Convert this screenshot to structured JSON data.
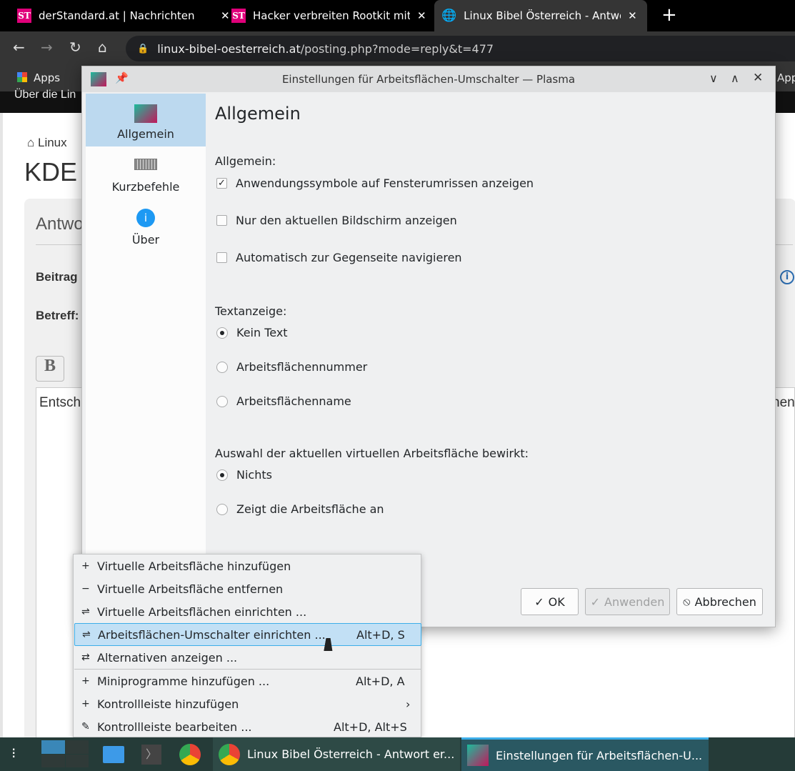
{
  "browser": {
    "tabs": [
      {
        "icon": "ST",
        "title": "derStandard.at | Nachrichten",
        "close": "✕"
      },
      {
        "icon": "ST",
        "title": "Hacker verbreiten Rootkit mit",
        "close": "✕"
      },
      {
        "icon": "globe-icon",
        "title": "Linux Bibel Österreich - Antwort",
        "close": "✕"
      }
    ],
    "new_tab": "+",
    "url_domain": "linux-bibel-oesterreich.at",
    "url_path": "/posting.php?mode=reply&t=477",
    "bookmarks": {
      "apps": "Apps",
      "right": "App"
    }
  },
  "webpage": {
    "top_text": "Über die Lin",
    "breadcrumb": "Linux",
    "heading": "KDE",
    "panel_title": "Antwo",
    "field1": "Beitrag",
    "field2": "Betreff:",
    "bold_button": "B",
    "textarea_start": "Entsch",
    "textarea_end": "nen"
  },
  "dialog": {
    "title": "Einstellungen für Arbeitsflächen-Umschalter — Plasma",
    "sidebar": [
      {
        "label": "Allgemein",
        "selected": true
      },
      {
        "label": "Kurzbefehle"
      },
      {
        "label": "Über"
      }
    ],
    "page_title": "Allgemein",
    "group1": {
      "label": "Allgemein:",
      "checkboxes": [
        {
          "label": "Anwendungssymbole auf Fensterumrissen anzeigen",
          "checked": true
        },
        {
          "label": "Nur den aktuellen Bildschirm anzeigen",
          "checked": false
        },
        {
          "label": "Automatisch zur Gegenseite navigieren",
          "checked": false
        }
      ]
    },
    "group2": {
      "label": "Textanzeige:",
      "radios": [
        {
          "label": "Kein Text",
          "checked": true
        },
        {
          "label": "Arbeitsflächennummer",
          "checked": false
        },
        {
          "label": "Arbeitsflächenname",
          "checked": false
        }
      ]
    },
    "group3": {
      "label": "Auswahl der aktuellen virtuellen Arbeitsfläche bewirkt:",
      "radios": [
        {
          "label": "Nichts",
          "checked": true
        },
        {
          "label": "Zeigt die Arbeitsfläche an",
          "checked": false
        }
      ]
    },
    "buttons": {
      "ok": "OK",
      "apply": "Anwenden",
      "cancel": "Abbrechen"
    }
  },
  "context_menu": [
    {
      "icon": "+",
      "label": "Virtuelle Arbeitsfläche hinzufügen",
      "shortcut": ""
    },
    {
      "icon": "−",
      "label": "Virtuelle Arbeitsfläche entfernen",
      "shortcut": ""
    },
    {
      "icon": "⇌",
      "label": "Virtuelle Arbeitsflächen einrichten ...",
      "shortcut": ""
    },
    {
      "icon": "⇌",
      "label": "Arbeitsflächen-Umschalter einrichten ...",
      "shortcut": "Alt+D, S",
      "highlighted": true
    },
    {
      "icon": "⇄",
      "label": "Alternativen anzeigen ...",
      "shortcut": ""
    },
    {
      "icon": "+",
      "label": "Miniprogramme hinzufügen ...",
      "shortcut": "Alt+D, A"
    },
    {
      "icon": "+",
      "label": "Kontrollleiste hinzufügen",
      "shortcut": "",
      "submenu": "›"
    },
    {
      "icon": "✎",
      "label": "Kontrollleiste bearbeiten ...",
      "shortcut": "Alt+D, Alt+S"
    }
  ],
  "taskbar": {
    "tasks": [
      {
        "label": "Linux Bibel Österreich - Antwort er..."
      },
      {
        "label": "Einstellungen für Arbeitsflächen-U...",
        "active": true
      }
    ]
  },
  "colors": {
    "accent": "#3daee9",
    "selection": "#bcd9ef",
    "brand_st": "#e0007a"
  }
}
